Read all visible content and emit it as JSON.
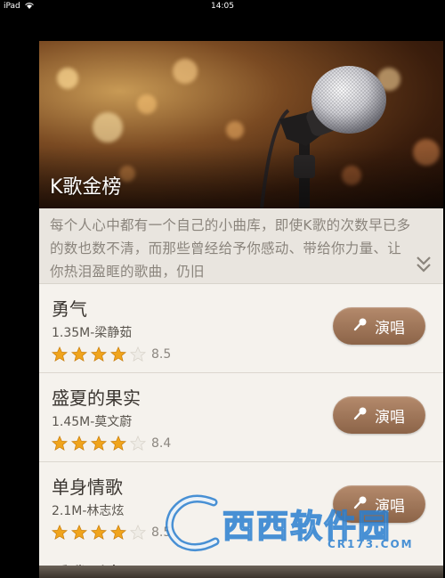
{
  "status_bar": {
    "device": "iPad",
    "time": "14:05"
  },
  "banner": {
    "title": "K歌金榜"
  },
  "description": {
    "text": "每个人心中都有一个自己的小曲库，即使K歌的次数早已多的数也数不清，而那些曾经给予你感动、带给你力量、让你热泪盈眶的歌曲，仍旧"
  },
  "songs": [
    {
      "title": "勇气",
      "meta": "1.35M-梁静茹",
      "rating": 4,
      "score": "8.5",
      "button": "演唱"
    },
    {
      "title": "盛夏的果实",
      "meta": "1.45M-莫文蔚",
      "rating": 4,
      "score": "8.4",
      "button": "演唱"
    },
    {
      "title": "单身情歌",
      "meta": "2.1M-林志炫",
      "rating": 4,
      "score": "8.5",
      "button": "演唱"
    }
  ],
  "next_song_peek": "爱我别走",
  "watermark": {
    "text": "西西软件园",
    "sub": "CR173.COM"
  },
  "colors": {
    "button": "#9c7456",
    "star": "#f0a41c",
    "star_empty": "#e4e0d8"
  }
}
